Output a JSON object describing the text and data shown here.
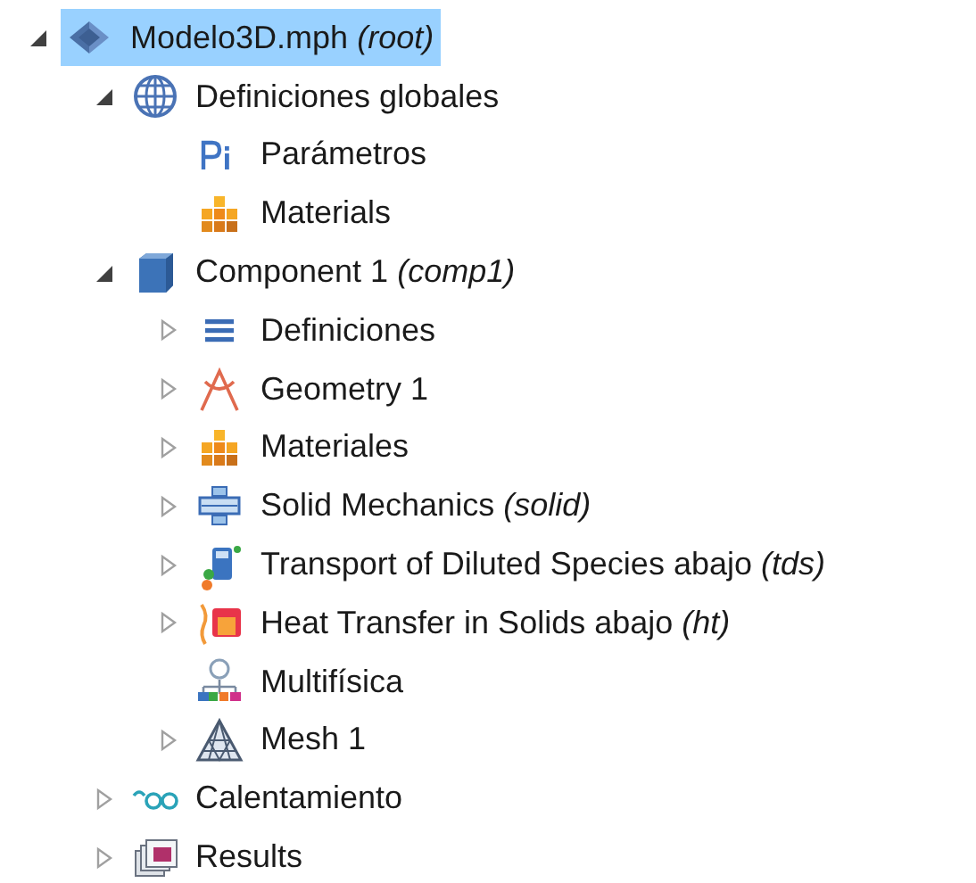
{
  "tree": [
    {
      "label": "Modelo3D.mph *(root)*",
      "kind": "root",
      "selected": true,
      "expanded": true,
      "children": [
        {
          "label": "Definiciones globales",
          "kind": "globals",
          "selected": false,
          "expanded": true,
          "children": [
            {
              "label": "Parámetros",
              "kind": "parameters",
              "selected": false
            },
            {
              "label": "Materials",
              "kind": "materials",
              "selected": false
            }
          ]
        },
        {
          "label": "Component 1 *(comp1)*",
          "kind": "component",
          "selected": false,
          "expanded": true,
          "children": [
            {
              "label": "Definiciones",
              "kind": "definitions",
              "selected": false,
              "expanded": false
            },
            {
              "label": "Geometry 1",
              "kind": "geometry",
              "selected": false,
              "expanded": false
            },
            {
              "label": "Materiales",
              "kind": "materials",
              "selected": false,
              "expanded": false
            },
            {
              "label": "Solid Mechanics *(solid)*",
              "kind": "solid",
              "selected": false,
              "expanded": false
            },
            {
              "label": "Transport of Diluted Species abajo *(tds)*",
              "kind": "transport",
              "selected": false,
              "expanded": false
            },
            {
              "label": "Heat Transfer in Solids abajo *(ht)*",
              "kind": "heat",
              "selected": false,
              "expanded": false
            },
            {
              "label": "Multifísica",
              "kind": "multiphysics",
              "selected": false
            },
            {
              "label": "Mesh 1",
              "kind": "mesh",
              "selected": false,
              "expanded": false
            }
          ]
        },
        {
          "label": "Calentamiento",
          "kind": "study",
          "selected": false,
          "expanded": false
        },
        {
          "label": "Results",
          "kind": "results",
          "selected": false,
          "expanded": false
        }
      ]
    }
  ]
}
